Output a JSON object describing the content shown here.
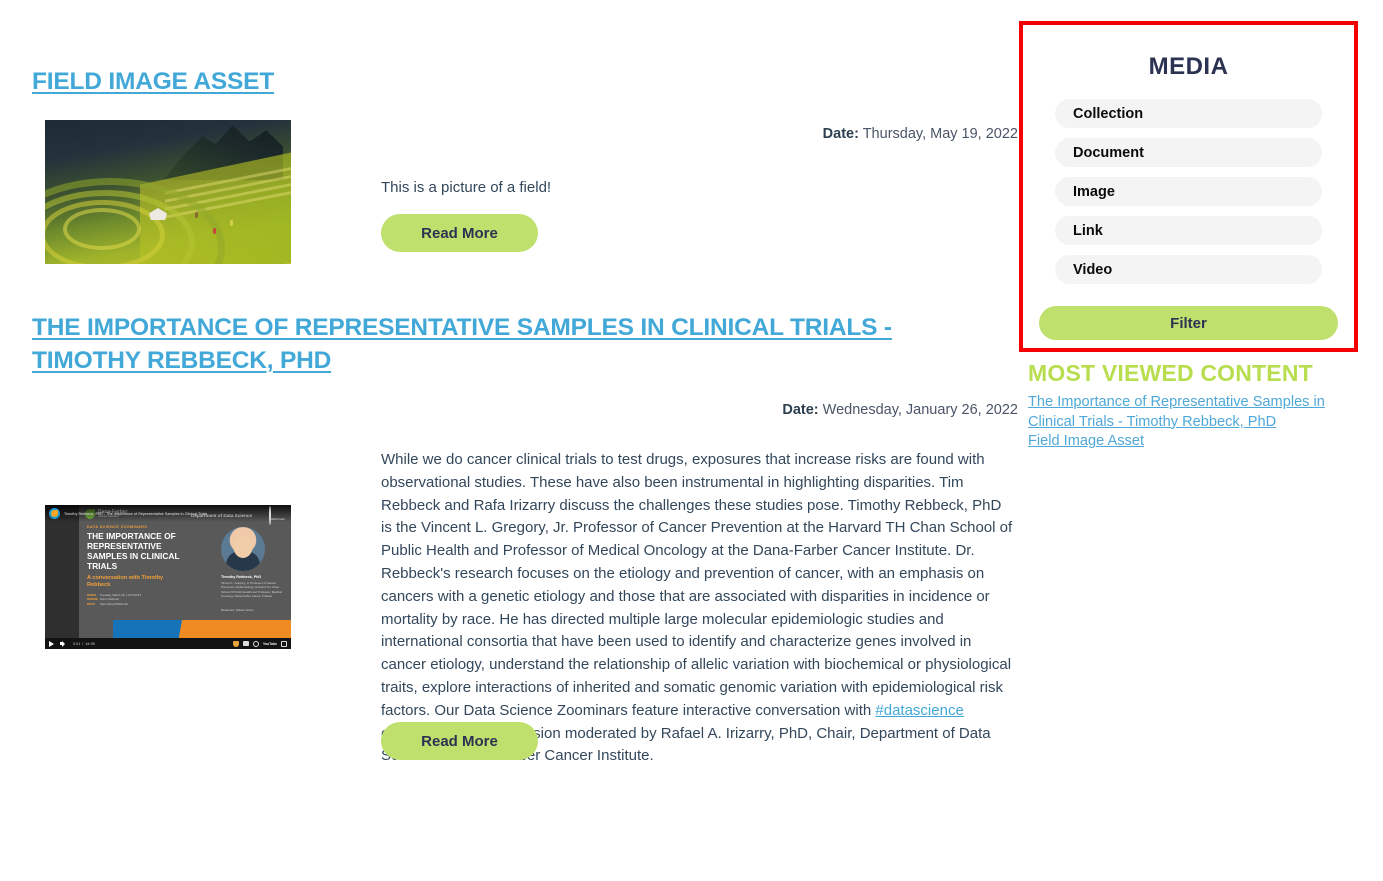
{
  "posts": [
    {
      "title": "FIELD IMAGE ASSET",
      "date_label": "Date:",
      "date_value": "Thursday, May 19, 2022",
      "body": "This is a picture of a field!",
      "read_more": "Read More",
      "thumb_alt": "field-image-thumbnail"
    },
    {
      "title": "THE IMPORTANCE OF REPRESENTATIVE SAMPLES IN CLINICAL TRIALS - TIMOTHY REBBECK, PHD",
      "date_label": "Date:",
      "date_value": "Wednesday, January 26, 2022",
      "body_part1": "While we do cancer clinical trials to test drugs, exposures that increase risks are found with observational studies. These have also been instrumental in highlighting disparities. Tim Rebbeck and Rafa Irizarry discuss the challenges these studies pose. Timothy Rebbeck, PhD is the Vincent L. Gregory, Jr. Professor of Cancer Prevention at the Harvard TH Chan School of Public Health and Professor of Medical Oncology at the Dana-Farber Cancer Institute. Dr. Rebbeck's research focuses on the etiology and prevention of cancer, with an emphasis on cancers with a genetic etiology and those that are associated with disparities in incidence or mortality by race. He has directed multiple large molecular epidemiologic studies and international consortia that have been used to identify and characterize genes involved in cancer etiology, understand the relationship of allelic variation with biochemical or physiological traits, explore interactions of inherited and somatic genomic variation with epidemiological risk factors. Our Data Science Zoominars feature interactive conversation with ",
      "body_link": "#datascience",
      "body_part2": " experts and a Q+A session moderated by Rafael A. Irizarry, PhD, Chair, Department of Data Science at Dana-Farber Cancer Institute.",
      "read_more": "Read More"
    }
  ],
  "video": {
    "top_title": "Timothy Rebbeck, PhD - The Importance of Representative Samples in Clinical Trials",
    "watch_later": "Watch later",
    "eyebrow": "DATA SCIENCE ZOOMINARS",
    "heading": "THE IMPORTANCE OF REPRESENTATIVE SAMPLES IN CLINICAL TRIALS",
    "conversation": "A conversation with Timothy Rebbeck",
    "meta_when_label": "WHEN",
    "meta_when_value": "Tuesday, March 23, 1:00 PM ET",
    "meta_where_label": "WHERE",
    "meta_where_value": "Zoom Webinar",
    "meta_rsvp_label": "RSVP",
    "meta_rsvp_value": "https://bit.ly/DSRev33",
    "speaker_name": "Timothy Rebbeck, PhD",
    "speaker_bio": "Vincent L. Gregory, Jr. Professor of Cancer Prevention, Epidemiology, Harvard T.H. Chan School Of Public Health and Professor, Medical Oncology, Dana-Farber Cancer Institute",
    "moderator": "Moderator: Rafael Irizarry",
    "brand": "Dana-Farber",
    "brand_sub": "Cancer Institute",
    "department": "Department of Data Science",
    "time_current": "0:01",
    "time_total": "44:09",
    "player_brand": "YouTube"
  },
  "sidebar": {
    "media_panel": {
      "title": "MEDIA",
      "options": [
        "Collection",
        "Document",
        "Image",
        "Link",
        "Video"
      ],
      "filter_button": "Filter"
    },
    "most_viewed": {
      "title": "MOST VIEWED CONTENT",
      "links": [
        "The Importance of Representative Samples in Clinical Trials - Timothy Rebbeck, PhD",
        "Field Image Asset"
      ]
    }
  },
  "colors": {
    "heading_blue": "#41a8d8",
    "accent_green": "#bfe06c",
    "mvc_green": "#b8de4f",
    "highlight_red": "#f40000",
    "text_dark": "#33475b",
    "pill_bg": "#f4f4f4"
  }
}
